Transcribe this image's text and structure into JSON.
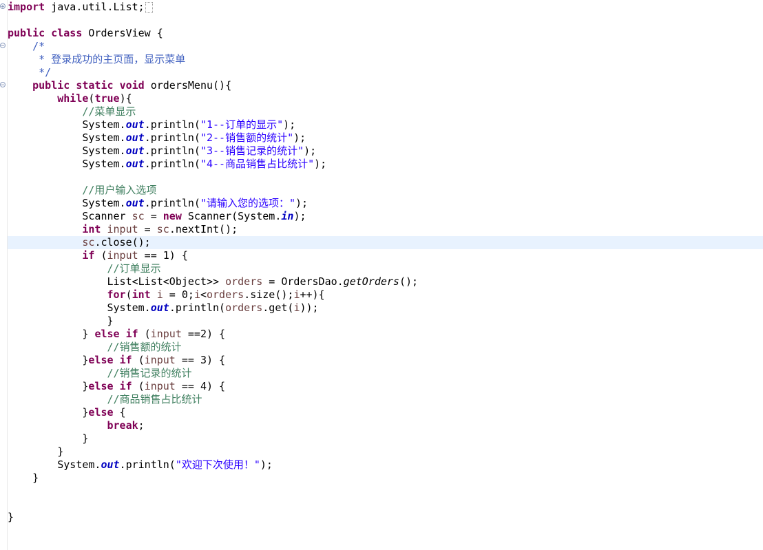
{
  "editor": {
    "lines": [
      [
        {
          "t": "kw",
          "v": "import"
        },
        {
          "t": "plain",
          "v": " java.util.List;"
        }
      ],
      [],
      [
        {
          "t": "kw",
          "v": "public"
        },
        {
          "t": "plain",
          "v": " "
        },
        {
          "t": "kw",
          "v": "class"
        },
        {
          "t": "plain",
          "v": " OrdersView {"
        }
      ],
      [
        {
          "t": "plain",
          "v": "    "
        },
        {
          "t": "jd",
          "v": "/*"
        }
      ],
      [
        {
          "t": "plain",
          "v": "     "
        },
        {
          "t": "jd",
          "v": "* 登录成功的主页面，显示菜单"
        }
      ],
      [
        {
          "t": "plain",
          "v": "     "
        },
        {
          "t": "jd",
          "v": "*/"
        }
      ],
      [
        {
          "t": "plain",
          "v": "    "
        },
        {
          "t": "kw",
          "v": "public"
        },
        {
          "t": "plain",
          "v": " "
        },
        {
          "t": "kw",
          "v": "static"
        },
        {
          "t": "plain",
          "v": " "
        },
        {
          "t": "kw",
          "v": "void"
        },
        {
          "t": "plain",
          "v": " ordersMenu(){"
        }
      ],
      [
        {
          "t": "plain",
          "v": "        "
        },
        {
          "t": "kw",
          "v": "while"
        },
        {
          "t": "plain",
          "v": "("
        },
        {
          "t": "kw",
          "v": "true"
        },
        {
          "t": "plain",
          "v": "){"
        }
      ],
      [
        {
          "t": "plain",
          "v": "            "
        },
        {
          "t": "cmt",
          "v": "//菜单显示"
        }
      ],
      [
        {
          "t": "plain",
          "v": "            System."
        },
        {
          "t": "fld",
          "v": "out"
        },
        {
          "t": "plain",
          "v": ".println("
        },
        {
          "t": "str",
          "v": "\"1--订单的显示\""
        },
        {
          "t": "plain",
          "v": ");"
        }
      ],
      [
        {
          "t": "plain",
          "v": "            System."
        },
        {
          "t": "fld",
          "v": "out"
        },
        {
          "t": "plain",
          "v": ".println("
        },
        {
          "t": "str",
          "v": "\"2--销售额的统计\""
        },
        {
          "t": "plain",
          "v": ");"
        }
      ],
      [
        {
          "t": "plain",
          "v": "            System."
        },
        {
          "t": "fld",
          "v": "out"
        },
        {
          "t": "plain",
          "v": ".println("
        },
        {
          "t": "str",
          "v": "\"3--销售记录的统计\""
        },
        {
          "t": "plain",
          "v": ");"
        }
      ],
      [
        {
          "t": "plain",
          "v": "            System."
        },
        {
          "t": "fld",
          "v": "out"
        },
        {
          "t": "plain",
          "v": ".println("
        },
        {
          "t": "str",
          "v": "\"4--商品销售占比统计\""
        },
        {
          "t": "plain",
          "v": ");"
        }
      ],
      [],
      [
        {
          "t": "plain",
          "v": "            "
        },
        {
          "t": "cmt",
          "v": "//用户输入选项"
        }
      ],
      [
        {
          "t": "plain",
          "v": "            System."
        },
        {
          "t": "fld",
          "v": "out"
        },
        {
          "t": "plain",
          "v": ".println("
        },
        {
          "t": "str",
          "v": "\"请输入您的选项：\""
        },
        {
          "t": "plain",
          "v": ");"
        }
      ],
      [
        {
          "t": "plain",
          "v": "            Scanner "
        },
        {
          "t": "var",
          "v": "sc"
        },
        {
          "t": "plain",
          "v": " = "
        },
        {
          "t": "kw",
          "v": "new"
        },
        {
          "t": "plain",
          "v": " Scanner(System."
        },
        {
          "t": "fld",
          "v": "in"
        },
        {
          "t": "plain",
          "v": ");"
        }
      ],
      [
        {
          "t": "plain",
          "v": "            "
        },
        {
          "t": "kw",
          "v": "int"
        },
        {
          "t": "plain",
          "v": " "
        },
        {
          "t": "var",
          "v": "input"
        },
        {
          "t": "plain",
          "v": " = "
        },
        {
          "t": "var",
          "v": "sc"
        },
        {
          "t": "plain",
          "v": ".nextInt();"
        }
      ],
      [
        {
          "t": "plain",
          "v": "            "
        },
        {
          "t": "var",
          "v": "sc"
        },
        {
          "t": "plain",
          "v": ".close();"
        }
      ],
      [
        {
          "t": "plain",
          "v": "            "
        },
        {
          "t": "kw",
          "v": "if"
        },
        {
          "t": "plain",
          "v": " ("
        },
        {
          "t": "var",
          "v": "input"
        },
        {
          "t": "plain",
          "v": " == 1) {"
        }
      ],
      [
        {
          "t": "plain",
          "v": "                "
        },
        {
          "t": "cmt",
          "v": "//订单显示"
        }
      ],
      [
        {
          "t": "plain",
          "v": "                List<List<Object>> "
        },
        {
          "t": "var",
          "v": "orders"
        },
        {
          "t": "plain",
          "v": " = OrdersDao."
        },
        {
          "t": "sm",
          "v": "getOrders"
        },
        {
          "t": "plain",
          "v": "();"
        }
      ],
      [
        {
          "t": "plain",
          "v": "                "
        },
        {
          "t": "kw",
          "v": "for"
        },
        {
          "t": "plain",
          "v": "("
        },
        {
          "t": "kw",
          "v": "int"
        },
        {
          "t": "plain",
          "v": " "
        },
        {
          "t": "var",
          "v": "i"
        },
        {
          "t": "plain",
          "v": " = 0;"
        },
        {
          "t": "var",
          "v": "i"
        },
        {
          "t": "plain",
          "v": "<"
        },
        {
          "t": "var",
          "v": "orders"
        },
        {
          "t": "plain",
          "v": ".size();"
        },
        {
          "t": "var",
          "v": "i"
        },
        {
          "t": "plain",
          "v": "++){"
        }
      ],
      [
        {
          "t": "plain",
          "v": "                System."
        },
        {
          "t": "fld",
          "v": "out"
        },
        {
          "t": "plain",
          "v": ".println("
        },
        {
          "t": "var",
          "v": "orders"
        },
        {
          "t": "plain",
          "v": ".get("
        },
        {
          "t": "var",
          "v": "i"
        },
        {
          "t": "plain",
          "v": "));"
        }
      ],
      [
        {
          "t": "plain",
          "v": "                }"
        }
      ],
      [
        {
          "t": "plain",
          "v": "            } "
        },
        {
          "t": "kw",
          "v": "else"
        },
        {
          "t": "plain",
          "v": " "
        },
        {
          "t": "kw",
          "v": "if"
        },
        {
          "t": "plain",
          "v": " ("
        },
        {
          "t": "var",
          "v": "input"
        },
        {
          "t": "plain",
          "v": " ==2) {"
        }
      ],
      [
        {
          "t": "plain",
          "v": "                "
        },
        {
          "t": "cmt",
          "v": "//销售额的统计"
        }
      ],
      [
        {
          "t": "plain",
          "v": "            }"
        },
        {
          "t": "kw",
          "v": "else"
        },
        {
          "t": "plain",
          "v": " "
        },
        {
          "t": "kw",
          "v": "if"
        },
        {
          "t": "plain",
          "v": " ("
        },
        {
          "t": "var",
          "v": "input"
        },
        {
          "t": "plain",
          "v": " == 3) {"
        }
      ],
      [
        {
          "t": "plain",
          "v": "                "
        },
        {
          "t": "cmt",
          "v": "//销售记录的统计"
        }
      ],
      [
        {
          "t": "plain",
          "v": "            }"
        },
        {
          "t": "kw",
          "v": "else"
        },
        {
          "t": "plain",
          "v": " "
        },
        {
          "t": "kw",
          "v": "if"
        },
        {
          "t": "plain",
          "v": " ("
        },
        {
          "t": "var",
          "v": "input"
        },
        {
          "t": "plain",
          "v": " == 4) {"
        }
      ],
      [
        {
          "t": "plain",
          "v": "                "
        },
        {
          "t": "cmt",
          "v": "//商品销售占比统计"
        }
      ],
      [
        {
          "t": "plain",
          "v": "            }"
        },
        {
          "t": "kw",
          "v": "else"
        },
        {
          "t": "plain",
          "v": " {"
        }
      ],
      [
        {
          "t": "plain",
          "v": "                "
        },
        {
          "t": "kw",
          "v": "break"
        },
        {
          "t": "plain",
          "v": ";"
        }
      ],
      [
        {
          "t": "plain",
          "v": "            }"
        }
      ],
      [
        {
          "t": "plain",
          "v": "        }"
        }
      ],
      [
        {
          "t": "plain",
          "v": "        System."
        },
        {
          "t": "fld",
          "v": "out"
        },
        {
          "t": "plain",
          "v": ".println("
        },
        {
          "t": "str",
          "v": "\"欢迎下次使用！\""
        },
        {
          "t": "plain",
          "v": ");"
        }
      ],
      [
        {
          "t": "plain",
          "v": "    }"
        }
      ],
      [],
      [],
      [
        {
          "t": "plain",
          "v": "}"
        }
      ]
    ],
    "current_line": 18,
    "collapsed_import_marker": "+",
    "fold_marker": "−"
  },
  "colors": {
    "keyword": "#7f0055",
    "string": "#2a00ff",
    "comment": "#3f7f5f",
    "javadoc": "#3f5fbf",
    "field": "#0000c0",
    "local_variable": "#6a3e3e",
    "current_line": "#e8f2fe"
  }
}
